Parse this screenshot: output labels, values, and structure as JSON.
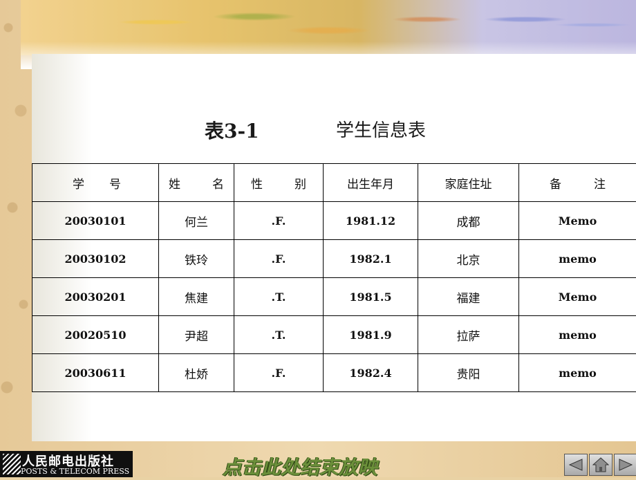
{
  "slide": {
    "table_number": "表3-1",
    "table_title": "学生信息表"
  },
  "table": {
    "headers": [
      {
        "left": "学",
        "right": "号"
      },
      {
        "left": "姓",
        "right": "名"
      },
      {
        "left": "性",
        "right": "别"
      },
      {
        "single": "出生年月"
      },
      {
        "single": "家庭住址"
      },
      {
        "left": "备",
        "right": "注"
      }
    ],
    "rows": [
      [
        "20030101",
        "何兰",
        ".F.",
        "1981.12",
        "成都",
        "Memo"
      ],
      [
        "20030102",
        "铁玲",
        ".F.",
        "1982.1",
        "北京",
        "memo"
      ],
      [
        "20030201",
        "焦建",
        ".T.",
        "1981.5",
        "福建",
        "Memo"
      ],
      [
        "20020510",
        "尹超",
        ".T.",
        "1981.9",
        "拉萨",
        "memo"
      ],
      [
        "20030611",
        "杜娇",
        ".F.",
        "1982.4",
        "贵阳",
        "memo"
      ]
    ]
  },
  "footer": {
    "publisher_cn": "人民邮电出版社",
    "publisher_en": "POSTS & TELECOM PRESS",
    "end_show": "点击此处结束放映"
  },
  "nav": {
    "icons": [
      "prev-icon",
      "home-icon",
      "next-icon"
    ]
  },
  "colors": {
    "end_show_text": "#6b8f3a",
    "panel": "#ffffff",
    "parchment": "#e9d2a4"
  }
}
